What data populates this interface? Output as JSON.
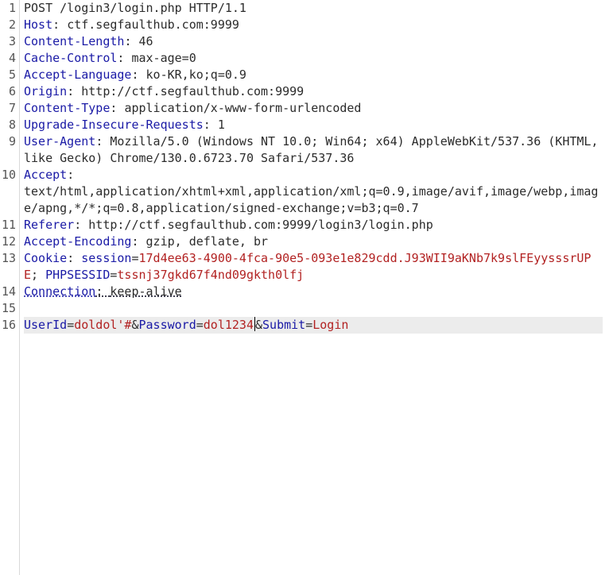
{
  "request": {
    "line1": "POST /login3/login.php HTTP/1.1",
    "headers": [
      {
        "name": "Host",
        "value": "ctf.segfaulthub.com:9999"
      },
      {
        "name": "Content-Length",
        "value": "46"
      },
      {
        "name": "Cache-Control",
        "value": "max-age=0"
      },
      {
        "name": "Accept-Language",
        "value": "ko-KR,ko;q=0.9"
      },
      {
        "name": "Origin",
        "value": "http://ctf.segfaulthub.com:9999"
      },
      {
        "name": "Content-Type",
        "value": "application/x-www-form-urlencoded"
      },
      {
        "name": "Upgrade-Insecure-Requests",
        "value": "1"
      },
      {
        "name": "User-Agent",
        "value": "Mozilla/5.0 (Windows NT 10.0; Win64; x64) AppleWebKit/537.36 (KHTML, like Gecko) Chrome/130.0.6723.70 Safari/537.36"
      },
      {
        "name": "Accept",
        "value": "text/html,application/xhtml+xml,application/xml;q=0.9,image/avif,image/webp,image/apng,*/*;q=0.8,application/signed-exchange;v=b3;q=0.7"
      },
      {
        "name": "Referer",
        "value": "http://ctf.segfaulthub.com:9999/login3/login.php"
      },
      {
        "name": "Accept-Encoding",
        "value": "gzip, deflate, br"
      }
    ],
    "cookie": {
      "header": "Cookie",
      "session_name": "session",
      "session_value": "17d4ee63-4900-4fca-90e5-093e1e829cdd.J93WII9aKNb7k9slFEyysssrUPE",
      "phpsessid_name": "PHPSESSID",
      "phpsessid_value": "tssnj37gkd67f4nd09gkth0lfj"
    },
    "connection": {
      "name": "Connection",
      "value": "keep-alive"
    },
    "body": {
      "p1_name": "UserId",
      "p1_value": "doldol'#",
      "p2_name": "Password",
      "p2_value": "dol1234",
      "p3_name": "Submit",
      "p3_value": "Login"
    }
  },
  "line_numbers": [
    "1",
    "2",
    "3",
    "4",
    "5",
    "6",
    "7",
    "8",
    "9",
    "10",
    "11",
    "12",
    "13",
    "14",
    "15",
    "16"
  ]
}
